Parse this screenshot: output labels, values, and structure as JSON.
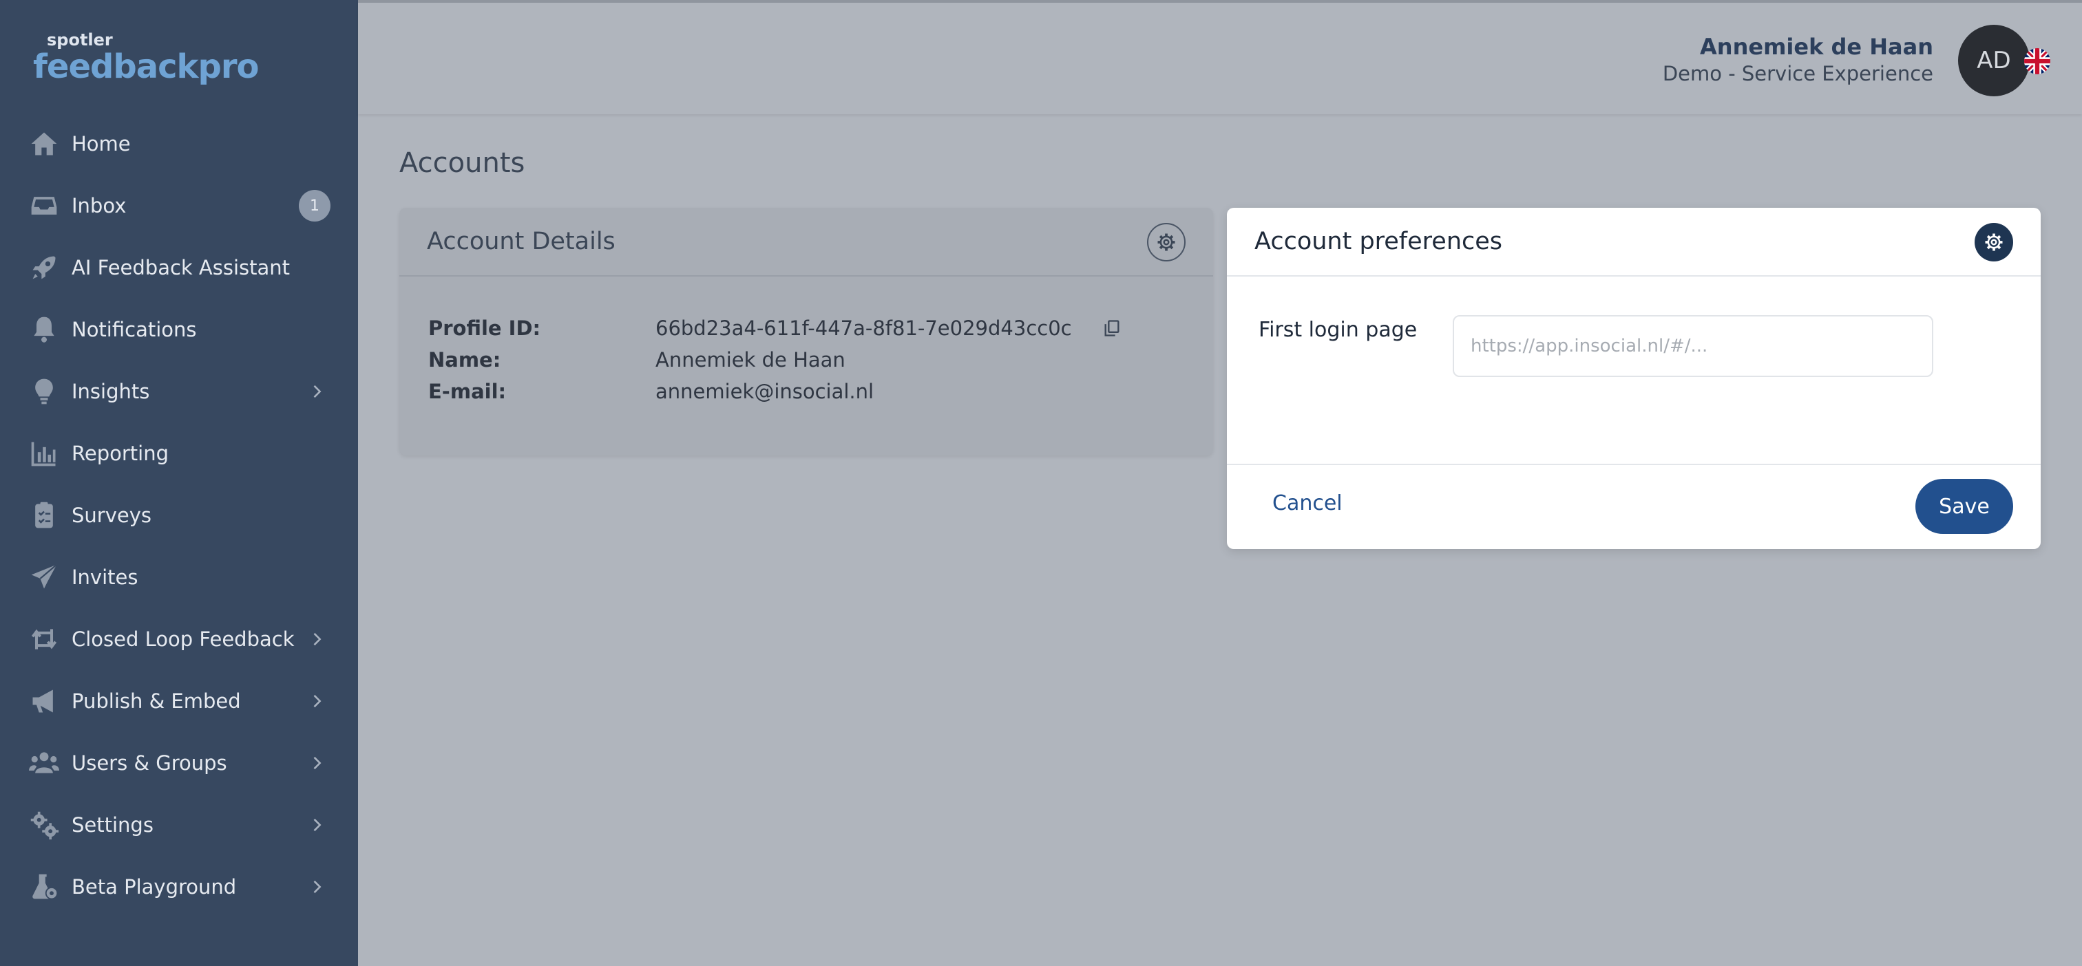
{
  "brand": {
    "small": "spotler",
    "big": "feedbackpro"
  },
  "sidebar": {
    "items": [
      {
        "label": "Home",
        "icon": "home-icon"
      },
      {
        "label": "Inbox",
        "icon": "inbox-icon",
        "badge": "1"
      },
      {
        "label": "AI Feedback Assistant",
        "icon": "rocket-icon"
      },
      {
        "label": "Notifications",
        "icon": "bell-icon"
      },
      {
        "label": "Insights",
        "icon": "lightbulb-icon",
        "expandable": true
      },
      {
        "label": "Reporting",
        "icon": "bar-chart-icon"
      },
      {
        "label": "Surveys",
        "icon": "clipboard-icon"
      },
      {
        "label": "Invites",
        "icon": "paper-plane-icon"
      },
      {
        "label": "Closed Loop Feedback",
        "icon": "loop-icon",
        "expandable": true
      },
      {
        "label": "Publish & Embed",
        "icon": "megaphone-icon",
        "expandable": true
      },
      {
        "label": "Users & Groups",
        "icon": "users-icon",
        "expandable": true
      },
      {
        "label": "Settings",
        "icon": "cogs-icon",
        "expandable": true
      },
      {
        "label": "Beta Playground",
        "icon": "flask-icon",
        "expandable": true
      }
    ]
  },
  "header": {
    "user_name": "Annemiek de Haan",
    "org": "Demo - Service Experience",
    "avatar_initials": "AD",
    "language_flag": "uk-flag-icon"
  },
  "page": {
    "title": "Accounts"
  },
  "account_details": {
    "title": "Account Details",
    "rows": [
      {
        "label": "Profile ID:",
        "value": "66bd23a4-611f-447a-8f81-7e029d43cc0c"
      },
      {
        "label": "Name:",
        "value": "Annemiek de Haan"
      },
      {
        "label": "E-mail:",
        "value": "annemiek@insocial.nl"
      }
    ]
  },
  "preferences": {
    "title": "Account preferences",
    "first_login_label": "First login page",
    "first_login_value": "",
    "first_login_placeholder": "https://app.insocial.nl/#/...",
    "cancel_label": "Cancel",
    "save_label": "Save"
  },
  "colors": {
    "sidebar_bg": "#374860",
    "accent": "#22508e",
    "overlay_bg": "#b0b5bd"
  }
}
